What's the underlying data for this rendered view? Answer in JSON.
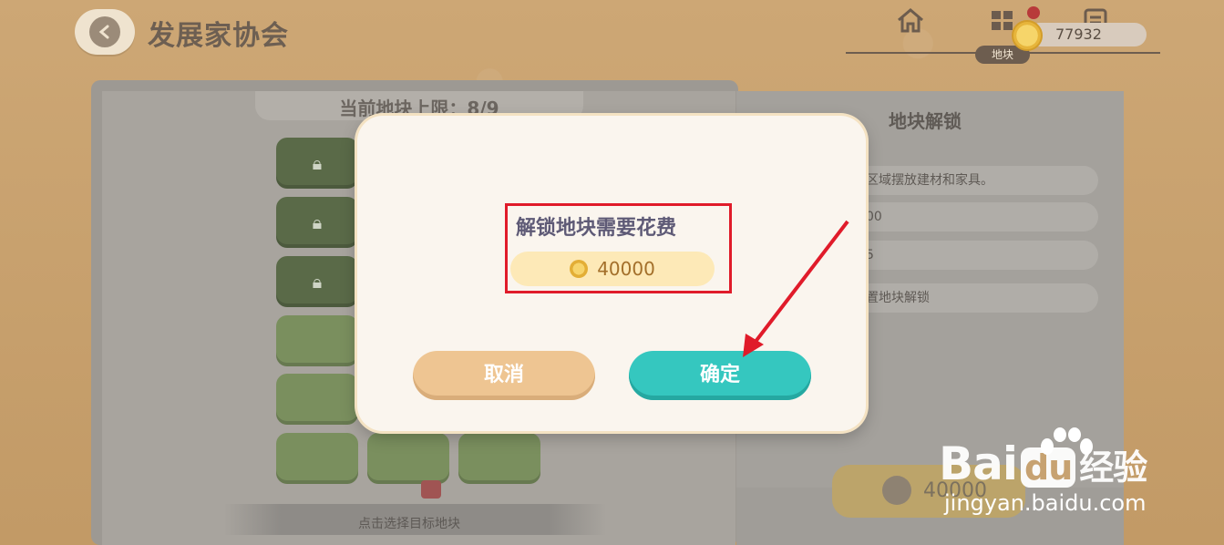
{
  "header": {
    "title": "发展家协会",
    "back_icon": "‹",
    "tab_label": "地块",
    "coins": "77932"
  },
  "left_panel": {
    "limit_text": "当前地块上限：8/9",
    "hint": "点击选择目标地块",
    "tiles": [
      {
        "state": "locked"
      },
      {
        "state": "locked"
      },
      {
        "state": "locked"
      },
      {
        "state": "open"
      },
      {
        "state": "open"
      },
      {
        "state": "open"
      },
      {
        "state": "open"
      },
      {
        "state": "open"
      }
    ]
  },
  "right_panel": {
    "title": "地块解锁",
    "rows": [
      "区域摆放建材和家具。",
      "00",
      "5",
      "置地块解锁"
    ],
    "button_value": "40000"
  },
  "dialog": {
    "message": "解锁地块需要花费",
    "cost": "40000",
    "cancel_label": "取消",
    "confirm_label": "确定"
  },
  "watermark": {
    "logo_text": "Bai",
    "logo_du": "du",
    "logo_cn": "经验",
    "site": "jingyan.baidu.com"
  },
  "colors": {
    "confirm": "#35c7bf",
    "cancel": "#eec592",
    "highlight": "#e01b2a"
  }
}
